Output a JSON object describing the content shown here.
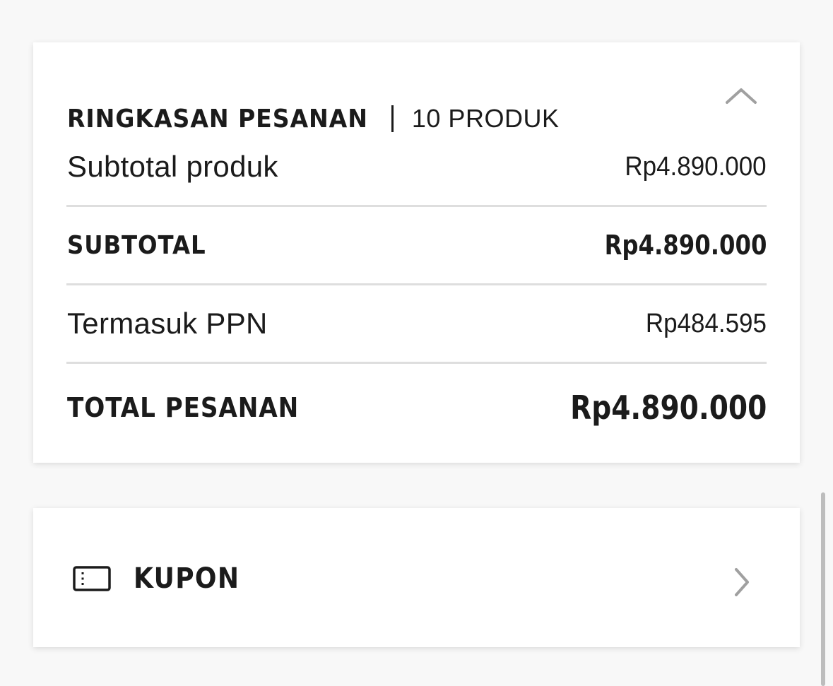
{
  "summary": {
    "title": "RINGKASAN PESANAN",
    "count": "10 PRODUK",
    "toggle_icon": "chevron-up-icon",
    "rows": [
      {
        "label": "Subtotal produk",
        "value": "Rp4.890.000"
      },
      {
        "label": "SUBTOTAL",
        "value": "Rp4.890.000"
      },
      {
        "label": "Termasuk PPN",
        "value": "Rp484.595"
      },
      {
        "label": "TOTAL PESANAN",
        "value": "Rp4.890.000"
      }
    ]
  },
  "coupon": {
    "label": "KUPON",
    "icon": "ticket-icon",
    "arrow_icon": "chevron-right-icon"
  },
  "colors": {
    "text": "#1b1b1b",
    "divider": "#dedede",
    "icon_gray": "#a0a0a0",
    "card_bg": "#ffffff",
    "page_bg": "#f8f8f8"
  }
}
